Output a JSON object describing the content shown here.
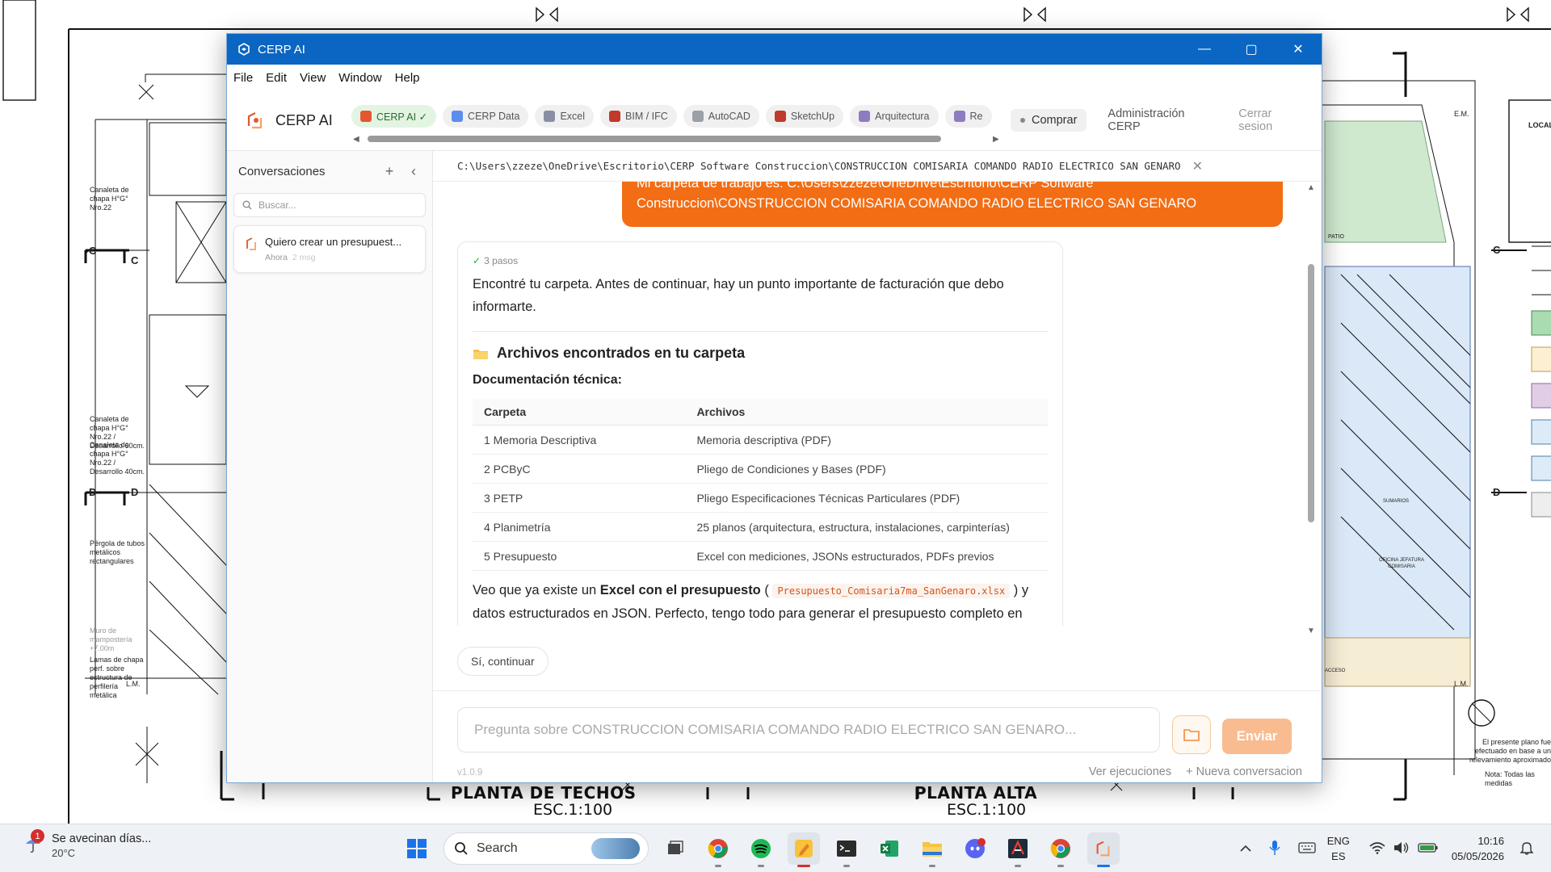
{
  "background": {
    "titles": [
      "PLANTA DE TECHOS",
      "PLANTA ALTA"
    ],
    "scales": [
      "ESC.1:100",
      "ESC.1:100"
    ],
    "section_marks": [
      "C",
      "C",
      "D",
      "D",
      "C",
      "D"
    ],
    "notes_left": [
      "Canaleta de chapa H°G° Nro.22",
      "Canaleta de chapa H°G° Nro.22 / Desarrollo 60cm.",
      "Canaleta de chapa H°G° Nro.22 / Desarrollo 40cm.",
      "Pérgola de tubos metálicos rectangulares",
      "Muro de mampostería +7.00m",
      "Lamas de chapa perf. sobre estructura de perfilería metálica"
    ],
    "notes_right": [
      "El presente plano fue efectuado en base a un relevamiento aproximado",
      "Nota: Todas las medidas"
    ],
    "labels": [
      "L.M.",
      "E.M.",
      "PATIO",
      "OFICINA JEFATURA COMISARIA",
      "SUMARIOS",
      "ACCESO",
      "LOCAL"
    ]
  },
  "window": {
    "title": "CERP AI",
    "controls": {
      "minimize": "—",
      "maximize": "▢",
      "close": "✕"
    }
  },
  "menu": [
    "File",
    "Edit",
    "View",
    "Window",
    "Help"
  ],
  "brand": {
    "name": "CERP AI"
  },
  "tabs": [
    {
      "label": "CERP AI ✓",
      "icon": "cerp-ai-icon",
      "color": "#e4572e"
    },
    {
      "label": "CERP Data",
      "icon": "cerp-data-icon",
      "color": "#5b8def"
    },
    {
      "label": "Excel",
      "icon": "excel-icon",
      "color": "#8a8fa3"
    },
    {
      "label": "BIM / IFC",
      "icon": "bim-icon",
      "color": "#c0392b"
    },
    {
      "label": "AutoCAD",
      "icon": "autocad-icon",
      "color": "#9aa0a6"
    },
    {
      "label": "SketchUp",
      "icon": "sketchup-icon",
      "color": "#c0392b"
    },
    {
      "label": "Arquitectura",
      "icon": "arquitectura-icon",
      "color": "#8e7cc3"
    },
    {
      "label": "Re",
      "icon": "document-icon",
      "color": "#8e7cc3"
    }
  ],
  "topbar": {
    "buy": "Comprar",
    "admin": "Administración CERP",
    "logout": "Cerrar sesion"
  },
  "sidebar": {
    "title": "Conversaciones",
    "add": "+",
    "collapse": "‹",
    "search_placeholder": "Buscar...",
    "conversations": [
      {
        "title": "Quiero crear un presupuest...",
        "time": "Ahora",
        "count": "2 msg"
      }
    ]
  },
  "path": {
    "value": "C:\\Users\\zzeze\\OneDrive\\Escritorio\\CERP Software Construccion\\CONSTRUCCION COMISARIA COMANDO RADIO ELECTRICO SAN GENARO",
    "close": "✕"
  },
  "chat": {
    "user_message": {
      "line1": "Mi carpeta de trabajo es: C:\\Users\\zzeze\\OneDrive\\Escritorio\\CERP Software",
      "line2": "Construccion\\CONSTRUCCION COMISARIA COMANDO RADIO ELECTRICO SAN GENARO"
    },
    "assistant": {
      "steps": "3 pasos",
      "intro": "Encontré tu carpeta. Antes de continuar, hay un punto importante de facturación que debo informarte.",
      "section_title": "Archivos encontrados en tu carpeta",
      "subsection": "Documentación técnica:",
      "table": {
        "headers": [
          "Carpeta",
          "Archivos"
        ],
        "rows": [
          [
            "1 Memoria Descriptiva",
            "Memoria descriptiva (PDF)"
          ],
          [
            "2 PCByC",
            "Pliego de Condiciones y Bases (PDF)"
          ],
          [
            "3 PETP",
            "Pliego Especificaciones Técnicas Particulares (PDF)"
          ],
          [
            "4 Planimetría",
            "25 planos (arquitectura, estructura, instalaciones, carpinterías)"
          ],
          [
            "5 Presupuesto",
            "Excel con mediciones, JSONs estructurados, PDFs previos"
          ]
        ]
      },
      "para_prefix": "Veo que ya existe un ",
      "para_bold": "Excel con el presupuesto",
      "para_open": " ( ",
      "para_file": "Presupuesto_Comisaria7ma_SanGenaro.xlsx",
      "para_suffix": " ) y datos estructurados en JSON. Perfecto, tengo todo para generar el presupuesto completo en CERP."
    },
    "quick_reply": "Sí, continuar"
  },
  "composer": {
    "placeholder": "Pregunta sobre CONSTRUCCION COMISARIA COMANDO RADIO ELECTRICO SAN GENARO...",
    "send": "Enviar",
    "version": "v1.0.9",
    "link_runs": "Ver ejecuciones",
    "link_new": "+ Nueva conversacion"
  },
  "taskbar": {
    "weather_text": "Se avecinan días...",
    "weather_temp": "20°C",
    "weather_badge": "1",
    "search": "Search",
    "lang1": "ENG",
    "lang2": "ES",
    "time": "10:16",
    "date": "05/05/2026",
    "apps": [
      "chrome-icon",
      "spotify-icon",
      "notes-icon",
      "terminal-icon",
      "excel-icon",
      "files-icon",
      "discord-icon",
      "autocad-icon",
      "chrome-alt-icon",
      "cerp-icon"
    ]
  },
  "colors": {
    "titlebar": "#0b66c3",
    "accent": "#f26d14",
    "send": "#f8bc90"
  }
}
